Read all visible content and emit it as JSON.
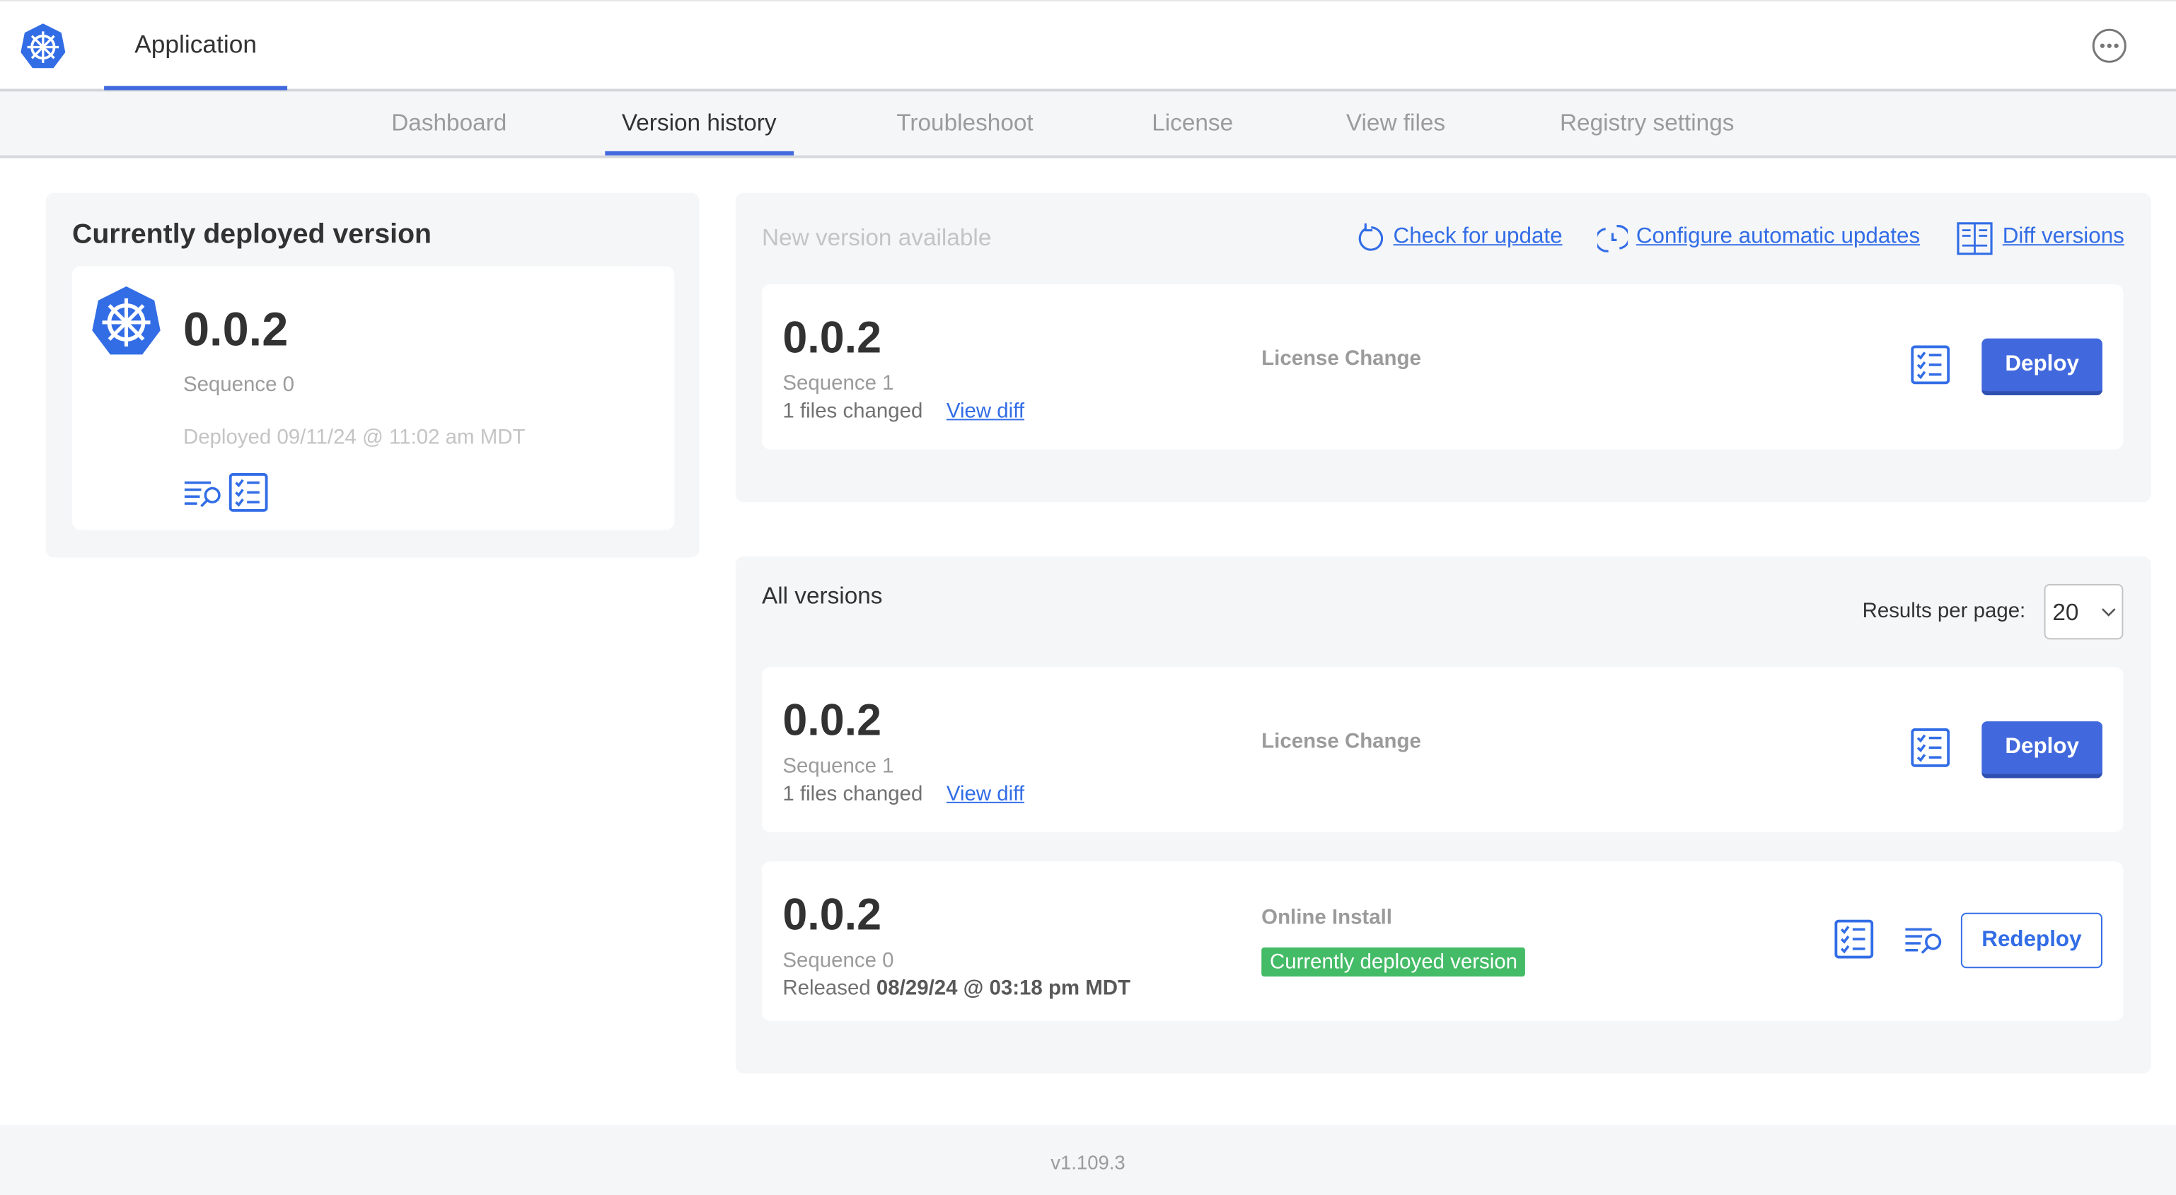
{
  "header": {
    "app_tab": "Application",
    "menu_icon": "ellipsis-circle-icon",
    "logo_icon": "kubernetes-helm-icon"
  },
  "nav": {
    "tabs": [
      {
        "label": "Dashboard"
      },
      {
        "label": "Version history",
        "active": true
      },
      {
        "label": "Troubleshoot"
      },
      {
        "label": "License"
      },
      {
        "label": "View files"
      },
      {
        "label": "Registry settings"
      }
    ]
  },
  "current": {
    "title": "Currently deployed version",
    "version": "0.0.2",
    "sequence": "Sequence 0",
    "deployed": "Deployed 09/11/24 @ 11:02 am MDT"
  },
  "new_version": {
    "title": "New version available",
    "check_update": "Check for update",
    "configure_updates": "Configure automatic updates",
    "diff_versions": "Diff versions",
    "row": {
      "version": "0.0.2",
      "sequence": "Sequence 1",
      "files_changed": "1 files changed",
      "view_diff": "View diff",
      "note": "License Change",
      "button": "Deploy"
    }
  },
  "all_versions": {
    "title": "All versions",
    "results_label": "Results per page:",
    "results_value": "20",
    "rows": [
      {
        "version": "0.0.2",
        "sequence": "Sequence 1",
        "files_changed": "1 files changed",
        "view_diff": "View diff",
        "note": "License Change",
        "button": "Deploy"
      },
      {
        "version": "0.0.2",
        "sequence": "Sequence 0",
        "released_label": "Released",
        "released": "08/29/24 @ 03:18 pm MDT",
        "note": "Online Install",
        "badge": "Currently deployed version",
        "button": "Redeploy"
      }
    ]
  },
  "footer": {
    "version": "v1.109.3"
  },
  "colors": {
    "accent": "#4169dd",
    "link": "#326de6",
    "badge": "#44bb66",
    "panel": "#f5f6f8"
  }
}
